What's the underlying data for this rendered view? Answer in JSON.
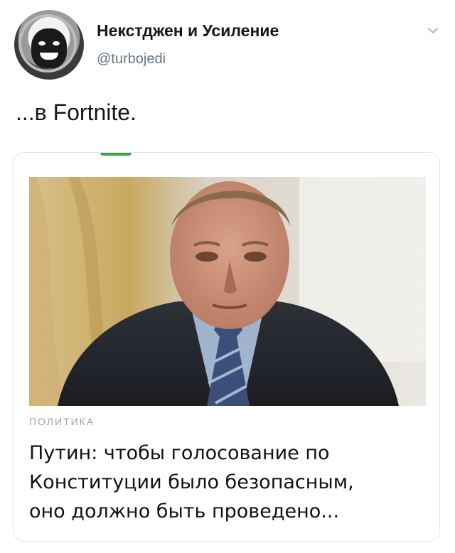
{
  "tweet": {
    "author_name": "Некстджен и Усиление",
    "author_handle": "@turbojedi",
    "text": "...в Fortnite.",
    "caret_icon": "chevron-down-icon",
    "avatar_icon": "astronaut-avatar"
  },
  "card": {
    "category": "ПОЛИТИКА",
    "title_lines": [
      "Путин: чтобы голосование по",
      "Конституции было безопасным,",
      "оно должно быть проведено..."
    ],
    "accent_color": "#3aa54a"
  },
  "colors": {
    "text_primary": "#14171a",
    "text_secondary": "#657786",
    "border": "#e1e8ed"
  }
}
